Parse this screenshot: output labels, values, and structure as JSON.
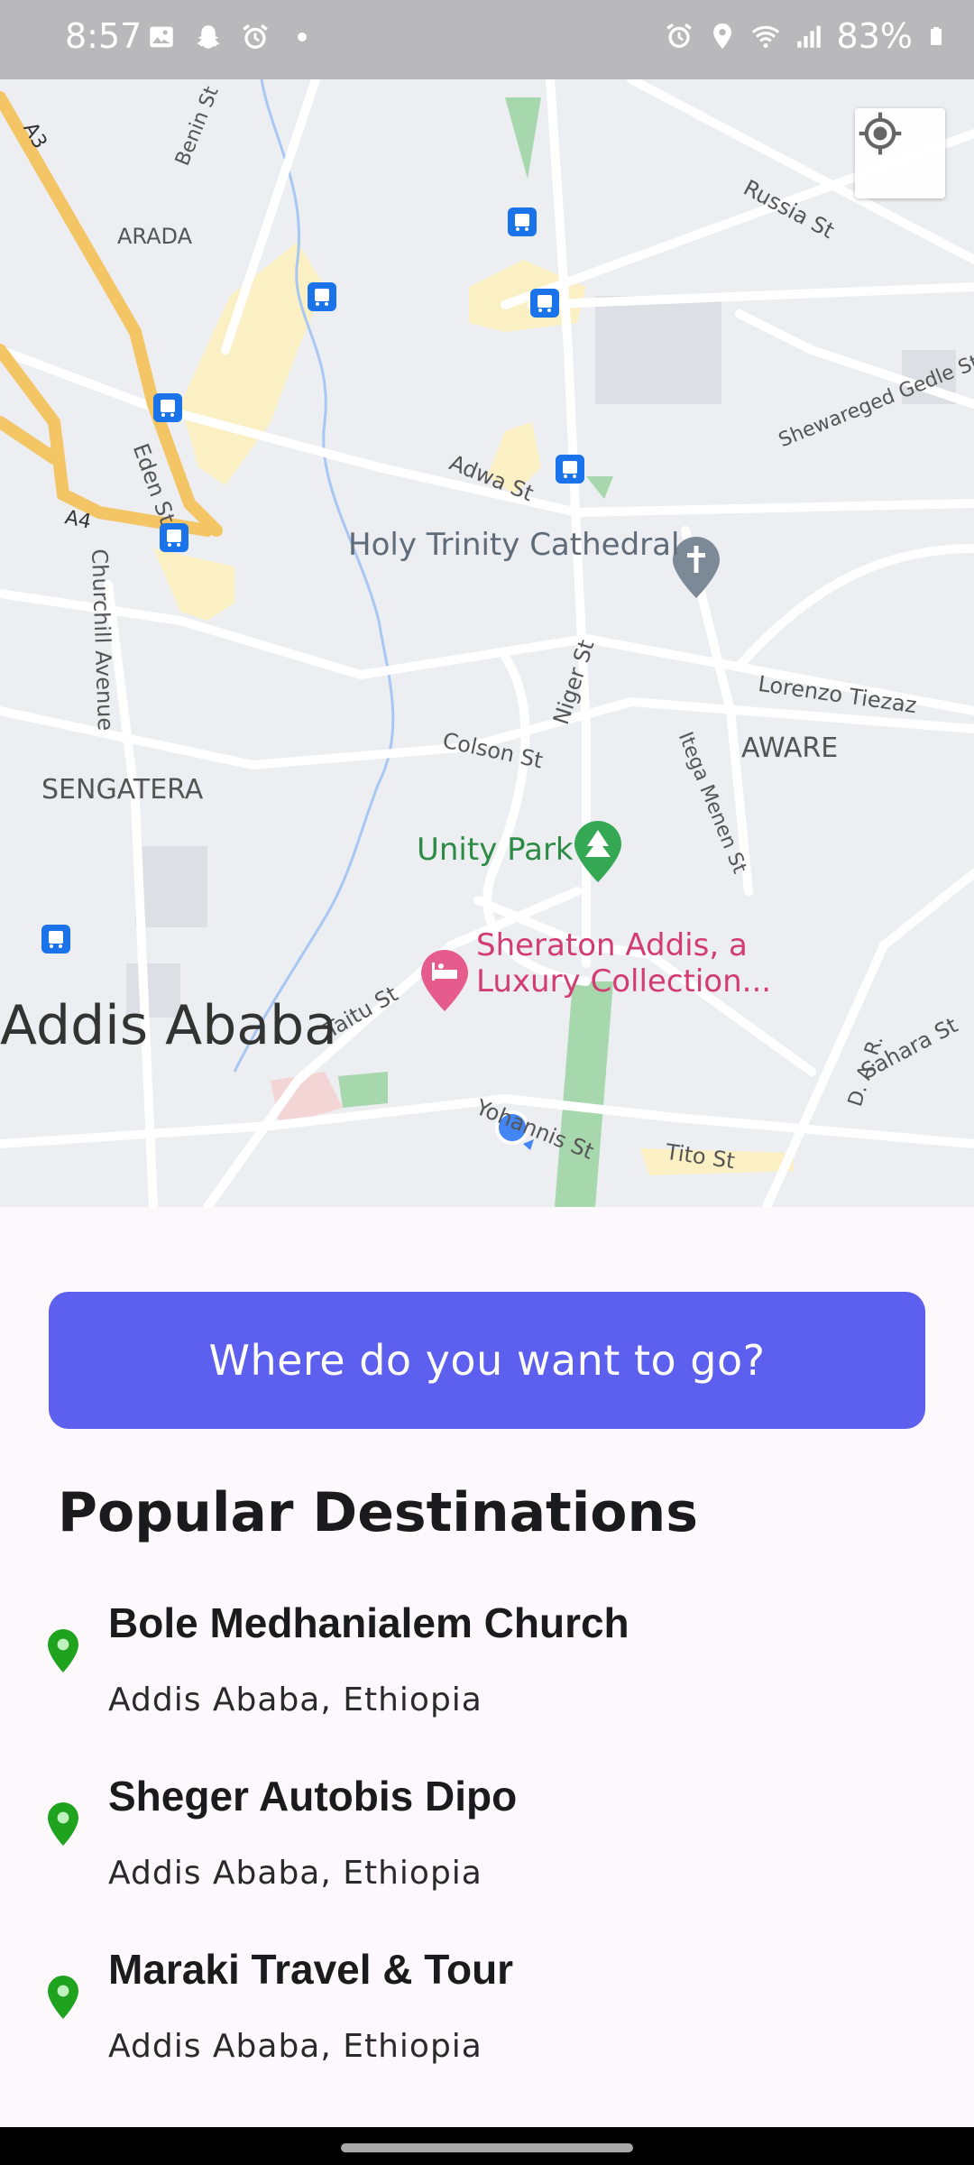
{
  "status_bar": {
    "time": "8:57",
    "battery": "83%",
    "left_icons": [
      "gallery-icon",
      "snapchat-icon",
      "alarm-icon",
      "dot-icon"
    ],
    "right_icons": [
      "alarm-icon",
      "location-icon",
      "wifi-icon",
      "signal-icon",
      "battery-icon"
    ]
  },
  "map": {
    "labels": {
      "arada": "ARADA",
      "benin_st": "Benin St",
      "a3": "A3",
      "a4": "A4",
      "eden_st": "Eden St",
      "churchill": "Churchill Avenue",
      "russia_st": "Russia St",
      "adwa_st": "Adwa St",
      "shewareged": "Shewareged Gedle St",
      "holy_trinity": "Holy Trinity Cathedral",
      "niger_st": "Niger St",
      "lorenzo": "Lorenzo Tiezaz",
      "colson": "Colson St",
      "aware": "AWARE",
      "itega": "Itega Menen St",
      "sengatera": "SENGATERA",
      "unity_park": "Unity Park",
      "sheraton_1": "Sheraton Addis, a",
      "sheraton_2": "Luxury Collection...",
      "taitu": "Taitu St",
      "addis": "Addis Ababa",
      "sahara": "Sahara St",
      "dar": "D. A. R.",
      "yohannis": "Yohannis St",
      "tito": "Tito St"
    },
    "colors": {
      "base": "#eceef1",
      "road": "#ffffff",
      "highway": "#f5c96a",
      "park": "#a6d7ad",
      "poi_pink": "#e55b8c",
      "poi_gray": "#7c8a97",
      "poi_green": "#34a853",
      "transit": "#1a73e8",
      "user_dot": "#4285f4"
    }
  },
  "search": {
    "label": "Where do you want to go?",
    "color": "#5d5fef"
  },
  "popular": {
    "title": "Popular Destinations",
    "items": [
      {
        "name": "Bole Medhanialem Church",
        "subtitle": "Addis Ababa, Ethiopia"
      },
      {
        "name": "Sheger Autobis Dipo",
        "subtitle": "Addis Ababa, Ethiopia"
      },
      {
        "name": "Maraki Travel & Tour",
        "subtitle": "Addis Ababa, Ethiopia"
      }
    ],
    "pin_color": "#1fa31f"
  }
}
